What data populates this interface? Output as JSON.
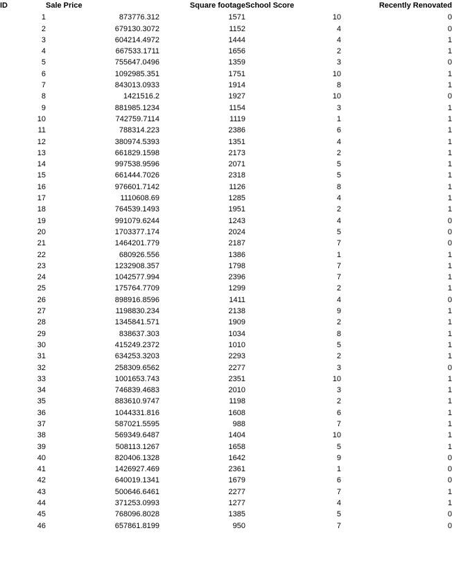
{
  "table": {
    "columns": [
      {
        "key": "id",
        "label": "ID"
      },
      {
        "key": "price",
        "label": "Sale Price"
      },
      {
        "key": "sqft",
        "label": "Square footage"
      },
      {
        "key": "school",
        "label": "School Score"
      },
      {
        "key": "renov",
        "label": "Recently Renovated"
      }
    ],
    "rows": [
      {
        "id": "1",
        "price": "873776.312",
        "sqft": "1571",
        "school": "10",
        "renov": "0"
      },
      {
        "id": "2",
        "price": "679130.3072",
        "sqft": "1152",
        "school": "4",
        "renov": "0"
      },
      {
        "id": "3",
        "price": "604214.4972",
        "sqft": "1444",
        "school": "4",
        "renov": "1"
      },
      {
        "id": "4",
        "price": "667533.1711",
        "sqft": "1656",
        "school": "2",
        "renov": "1"
      },
      {
        "id": "5",
        "price": "755647.0496",
        "sqft": "1359",
        "school": "3",
        "renov": "0"
      },
      {
        "id": "6",
        "price": "1092985.351",
        "sqft": "1751",
        "school": "10",
        "renov": "1"
      },
      {
        "id": "7",
        "price": "843013.0933",
        "sqft": "1914",
        "school": "8",
        "renov": "1"
      },
      {
        "id": "8",
        "price": "1421516.2",
        "sqft": "1927",
        "school": "10",
        "renov": "0"
      },
      {
        "id": "9",
        "price": "881985.1234",
        "sqft": "1154",
        "school": "3",
        "renov": "1"
      },
      {
        "id": "10",
        "price": "742759.7114",
        "sqft": "1119",
        "school": "1",
        "renov": "1"
      },
      {
        "id": "11",
        "price": "788314.223",
        "sqft": "2386",
        "school": "6",
        "renov": "1"
      },
      {
        "id": "12",
        "price": "380974.5393",
        "sqft": "1351",
        "school": "4",
        "renov": "1"
      },
      {
        "id": "13",
        "price": "661829.1598",
        "sqft": "2173",
        "school": "2",
        "renov": "1"
      },
      {
        "id": "14",
        "price": "997538.9596",
        "sqft": "2071",
        "school": "5",
        "renov": "1"
      },
      {
        "id": "15",
        "price": "661444.7026",
        "sqft": "2318",
        "school": "5",
        "renov": "1"
      },
      {
        "id": "16",
        "price": "976601.7142",
        "sqft": "1126",
        "school": "8",
        "renov": "1"
      },
      {
        "id": "17",
        "price": "1110608.69",
        "sqft": "1285",
        "school": "4",
        "renov": "1"
      },
      {
        "id": "18",
        "price": "764539.1493",
        "sqft": "1951",
        "school": "2",
        "renov": "1"
      },
      {
        "id": "19",
        "price": "991079.6244",
        "sqft": "1243",
        "school": "4",
        "renov": "0"
      },
      {
        "id": "20",
        "price": "1703377.174",
        "sqft": "2024",
        "school": "5",
        "renov": "0"
      },
      {
        "id": "21",
        "price": "1464201.779",
        "sqft": "2187",
        "school": "7",
        "renov": "0"
      },
      {
        "id": "22",
        "price": "680926.556",
        "sqft": "1386",
        "school": "1",
        "renov": "1"
      },
      {
        "id": "23",
        "price": "1232908.357",
        "sqft": "1798",
        "school": "7",
        "renov": "1"
      },
      {
        "id": "24",
        "price": "1042577.994",
        "sqft": "2396",
        "school": "7",
        "renov": "1"
      },
      {
        "id": "25",
        "price": "175764.7709",
        "sqft": "1299",
        "school": "2",
        "renov": "1"
      },
      {
        "id": "26",
        "price": "898916.8596",
        "sqft": "1411",
        "school": "4",
        "renov": "0"
      },
      {
        "id": "27",
        "price": "1198830.234",
        "sqft": "2138",
        "school": "9",
        "renov": "1"
      },
      {
        "id": "28",
        "price": "1345841.571",
        "sqft": "1909",
        "school": "2",
        "renov": "1"
      },
      {
        "id": "29",
        "price": "838637.303",
        "sqft": "1034",
        "school": "8",
        "renov": "1"
      },
      {
        "id": "30",
        "price": "415249.2372",
        "sqft": "1010",
        "school": "5",
        "renov": "1"
      },
      {
        "id": "31",
        "price": "634253.3203",
        "sqft": "2293",
        "school": "2",
        "renov": "1"
      },
      {
        "id": "32",
        "price": "258309.6562",
        "sqft": "2277",
        "school": "3",
        "renov": "0"
      },
      {
        "id": "33",
        "price": "1001653.743",
        "sqft": "2351",
        "school": "10",
        "renov": "1"
      },
      {
        "id": "34",
        "price": "746839.4683",
        "sqft": "2010",
        "school": "3",
        "renov": "1"
      },
      {
        "id": "35",
        "price": "883610.9747",
        "sqft": "1198",
        "school": "2",
        "renov": "1"
      },
      {
        "id": "36",
        "price": "1044331.816",
        "sqft": "1608",
        "school": "6",
        "renov": "1"
      },
      {
        "id": "37",
        "price": "587021.5595",
        "sqft": "988",
        "school": "7",
        "renov": "1"
      },
      {
        "id": "38",
        "price": "569349.6487",
        "sqft": "1404",
        "school": "10",
        "renov": "1"
      },
      {
        "id": "39",
        "price": "508113.1267",
        "sqft": "1658",
        "school": "5",
        "renov": "1"
      },
      {
        "id": "40",
        "price": "820406.1328",
        "sqft": "1642",
        "school": "9",
        "renov": "0"
      },
      {
        "id": "41",
        "price": "1426927.469",
        "sqft": "2361",
        "school": "1",
        "renov": "0"
      },
      {
        "id": "42",
        "price": "640019.1341",
        "sqft": "1679",
        "school": "6",
        "renov": "0"
      },
      {
        "id": "43",
        "price": "500646.6461",
        "sqft": "2277",
        "school": "7",
        "renov": "1"
      },
      {
        "id": "44",
        "price": "371253.0993",
        "sqft": "1277",
        "school": "4",
        "renov": "1"
      },
      {
        "id": "45",
        "price": "768096.8028",
        "sqft": "1385",
        "school": "5",
        "renov": "0"
      },
      {
        "id": "46",
        "price": "657861.8199",
        "sqft": "950",
        "school": "7",
        "renov": "0"
      }
    ]
  }
}
